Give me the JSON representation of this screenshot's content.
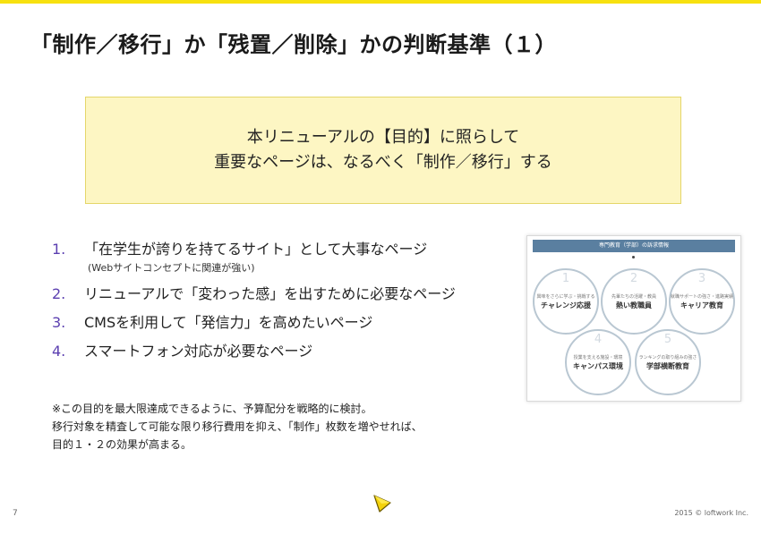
{
  "title": "「制作／移行」か「残置／削除」かの判断基準（１）",
  "callout": {
    "line1": "本リニューアルの【目的】に照らして",
    "line2": "重要なページは、なるべく「制作／移行」する"
  },
  "list": [
    {
      "num": "1.",
      "text": "「在学生が誇りを持てるサイト」として大事なページ",
      "sub": "(Webサイトコンセプトに関連が強い)"
    },
    {
      "num": "2.",
      "text": "リニューアルで「変わった感」を出すために必要なページ"
    },
    {
      "num": "3.",
      "text": "CMSを利用して「発信力」を高めたいページ"
    },
    {
      "num": "4.",
      "text": "スマートフォン対応が必要なページ"
    }
  ],
  "note": {
    "line1": "※この目的を最大限達成できるように、予算配分を戦略的に検討。",
    "line2": "移行対象を精査して可能な限り移行費用を抑え、「制作」枚数を増やせれば、",
    "line3": "目的１・２の効果が高まる。"
  },
  "thumbnail": {
    "header": "専門教育（学部）の訴求情報",
    "circles": [
      {
        "num": "1",
        "small": "興味をさらに学ぶ・挑戦する",
        "label": "チャレンジ応援"
      },
      {
        "num": "2",
        "small": "先輩たちの活躍・教員",
        "label": "熱い教職員"
      },
      {
        "num": "3",
        "small": "就職サポートの強さ・進路実績",
        "label": "キャリア教育"
      },
      {
        "num": "4",
        "small": "授業を支える施設・環境",
        "label": "キャンパス環境"
      },
      {
        "num": "5",
        "small": "ランキングの取り組みの強さ",
        "label": "学部横断教育"
      }
    ]
  },
  "footer": {
    "page_number": "7",
    "copyright": "2015 © loftwork Inc."
  },
  "colors": {
    "accent_bar": "#f7e10f",
    "callout_bg": "#fdf6c3",
    "list_number": "#5b3fb0"
  },
  "icons": {
    "logo": "loftwork-logo-icon"
  }
}
